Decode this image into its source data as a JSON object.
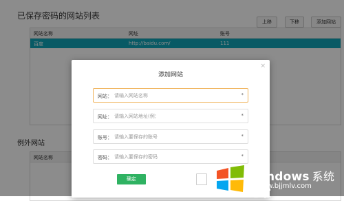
{
  "page": {
    "saved_title": "已保存密码的网站列表",
    "excluded_title": "例外网站",
    "buttons": {
      "up": "上移",
      "down": "下移",
      "add": "添加网站"
    },
    "saved_table": {
      "headers": [
        "网站名称",
        "网址",
        "账号"
      ],
      "rows": [
        {
          "name": "百度",
          "url": "http://baidu.com/",
          "account": "111"
        }
      ]
    },
    "excluded_table": {
      "headers": [
        "网站名称"
      ]
    }
  },
  "dialog": {
    "title": "添加网站",
    "close": "×",
    "fields": [
      {
        "label": "网站：",
        "placeholder": "请输入网站名称",
        "required": "*"
      },
      {
        "label": "网址：",
        "placeholder": "请输入网站地址(例：",
        "required": "*"
      },
      {
        "label": "账号：",
        "placeholder": "请输入要保存的账号",
        "required": "*"
      },
      {
        "label": "密码：",
        "placeholder": "请输入要保存的密码",
        "required": "*"
      }
    ],
    "ok": "确定"
  },
  "watermark": {
    "title": "Windows",
    "title_cn": "系统之家",
    "url": "www.bjjmlv.com"
  },
  "colors": {
    "selected_row": "#0fa5b8",
    "ok_button": "#2fb262",
    "active_field_border": "#f0b35a"
  }
}
